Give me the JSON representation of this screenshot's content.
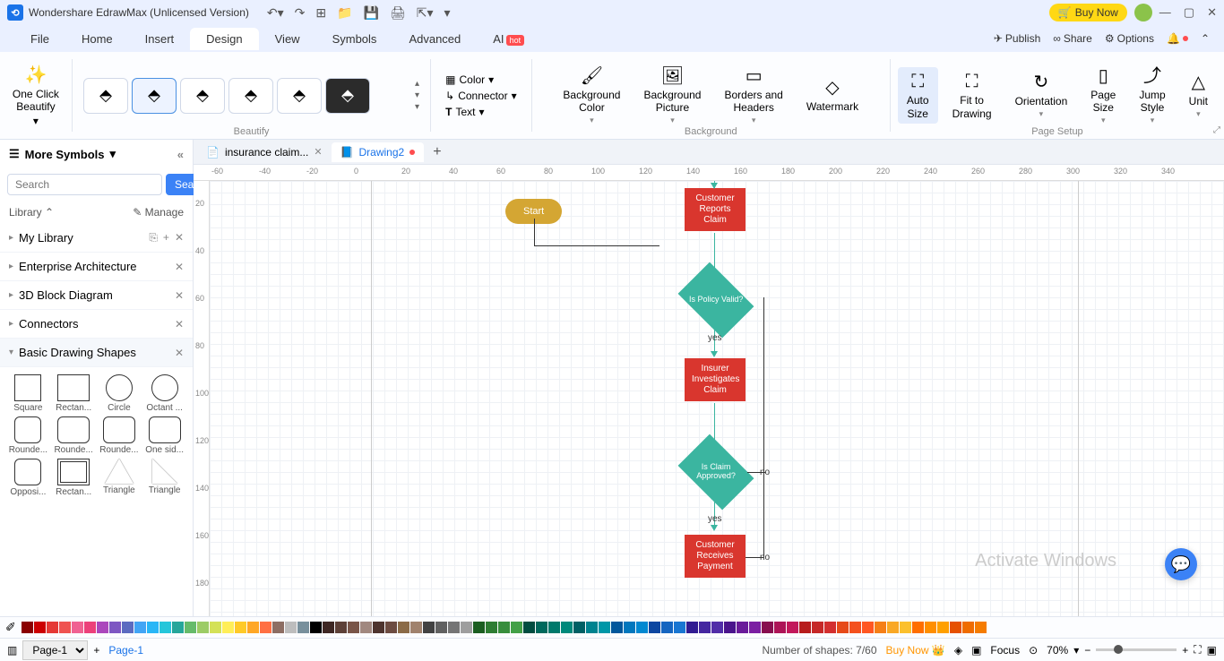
{
  "title": "Wondershare EdrawMax (Unlicensed Version)",
  "buyNow": "Buy Now",
  "menu": {
    "file": "File",
    "home": "Home",
    "insert": "Insert",
    "design": "Design",
    "view": "View",
    "symbols": "Symbols",
    "advanced": "Advanced",
    "ai": "AI",
    "hot": "hot",
    "publish": "Publish",
    "share": "Share",
    "options": "Options"
  },
  "ribbon": {
    "oneClick": "One Click\nBeautify",
    "beautifyLabel": "Beautify",
    "color": "Color",
    "connector": "Connector",
    "text": "Text",
    "bgColor": "Background\nColor",
    "bgPicture": "Background\nPicture",
    "borders": "Borders and\nHeaders",
    "watermark": "Watermark",
    "backgroundLabel": "Background",
    "autoSize": "Auto\nSize",
    "fitDrawing": "Fit to\nDrawing",
    "orientation": "Orientation",
    "pageSize": "Page\nSize",
    "jumpStyle": "Jump\nStyle",
    "unit": "Unit",
    "pageSetupLabel": "Page Setup"
  },
  "leftPanel": {
    "moreSymbols": "More Symbols",
    "searchPlaceholder": "Search",
    "searchBtn": "Search",
    "library": "Library",
    "manage": "Manage",
    "cats": {
      "myLibrary": "My Library",
      "enterprise": "Enterprise Architecture",
      "block3d": "3D Block Diagram",
      "connectors": "Connectors",
      "basic": "Basic Drawing Shapes"
    },
    "shapes": [
      "Square",
      "Rectan...",
      "Circle",
      "Octant ...",
      "Rounde...",
      "Rounde...",
      "Rounde...",
      "One sid...",
      "Opposi...",
      "Rectan...",
      "Triangle",
      "Triangle"
    ]
  },
  "tabs": {
    "t1": "insurance claim...",
    "t2": "Drawing2"
  },
  "flowchart": {
    "start": "Start",
    "reports": "Customer Reports Claim",
    "policy": "Is Policy Valid?",
    "yes1": "yes",
    "investigates": "Insurer Investigates Claim",
    "approved": "Is Claim Approved?",
    "no1": "no",
    "yes2": "yes",
    "receives": "Customer Receives Payment",
    "no2": "no"
  },
  "status": {
    "page": "Page-1",
    "pageLabel": "Page-1",
    "shapesCount": "Number of shapes: 7/60",
    "buyNow": "Buy Now",
    "focus": "Focus",
    "zoom": "70%"
  },
  "watermark": "Activate Windows",
  "rulerH": [
    "-60",
    "-40",
    "-20",
    "0",
    "20",
    "40",
    "60",
    "80",
    "100",
    "120",
    "140",
    "160",
    "180",
    "200",
    "220",
    "240",
    "260",
    "280",
    "300",
    "320",
    "340"
  ],
  "rulerV": [
    "20",
    "40",
    "60",
    "80",
    "100",
    "120",
    "140",
    "160",
    "180"
  ],
  "colors": [
    "#8b0000",
    "#c00",
    "#e53935",
    "#ef5350",
    "#f06292",
    "#ec407a",
    "#ab47bc",
    "#7e57c2",
    "#5c6bc0",
    "#42a5f5",
    "#29b6f6",
    "#26c6da",
    "#26a69a",
    "#66bb6a",
    "#9ccc65",
    "#d4e157",
    "#ffee58",
    "#ffca28",
    "#ffa726",
    "#ff7043",
    "#8d6e63",
    "#bdbdbd",
    "#78909c",
    "#000",
    "#3e2723",
    "#5d4037",
    "#795548",
    "#a1887f",
    "#4e342e",
    "#6d4c41",
    "#8b6b47",
    "#a0826d",
    "#424242",
    "#616161",
    "#757575",
    "#9e9e9e",
    "#1b5e20",
    "#2e7d32",
    "#388e3c",
    "#43a047",
    "#004d40",
    "#00695c",
    "#00796b",
    "#00897b",
    "#006064",
    "#00838f",
    "#0097a7",
    "#01579b",
    "#0277bd",
    "#0288d1",
    "#0d47a1",
    "#1565c0",
    "#1976d2",
    "#311b92",
    "#4527a0",
    "#512da8",
    "#4a148c",
    "#6a1b9a",
    "#7b1fa2",
    "#880e4f",
    "#ad1457",
    "#c2185b",
    "#b71c1c",
    "#c62828",
    "#d32f2f",
    "#e64a19",
    "#f4511e",
    "#ff5722",
    "#f57f17",
    "#f9a825",
    "#fbc02d",
    "#ff6f00",
    "#ff8f00",
    "#ffa000",
    "#e65100",
    "#ef6c00",
    "#f57c00"
  ]
}
